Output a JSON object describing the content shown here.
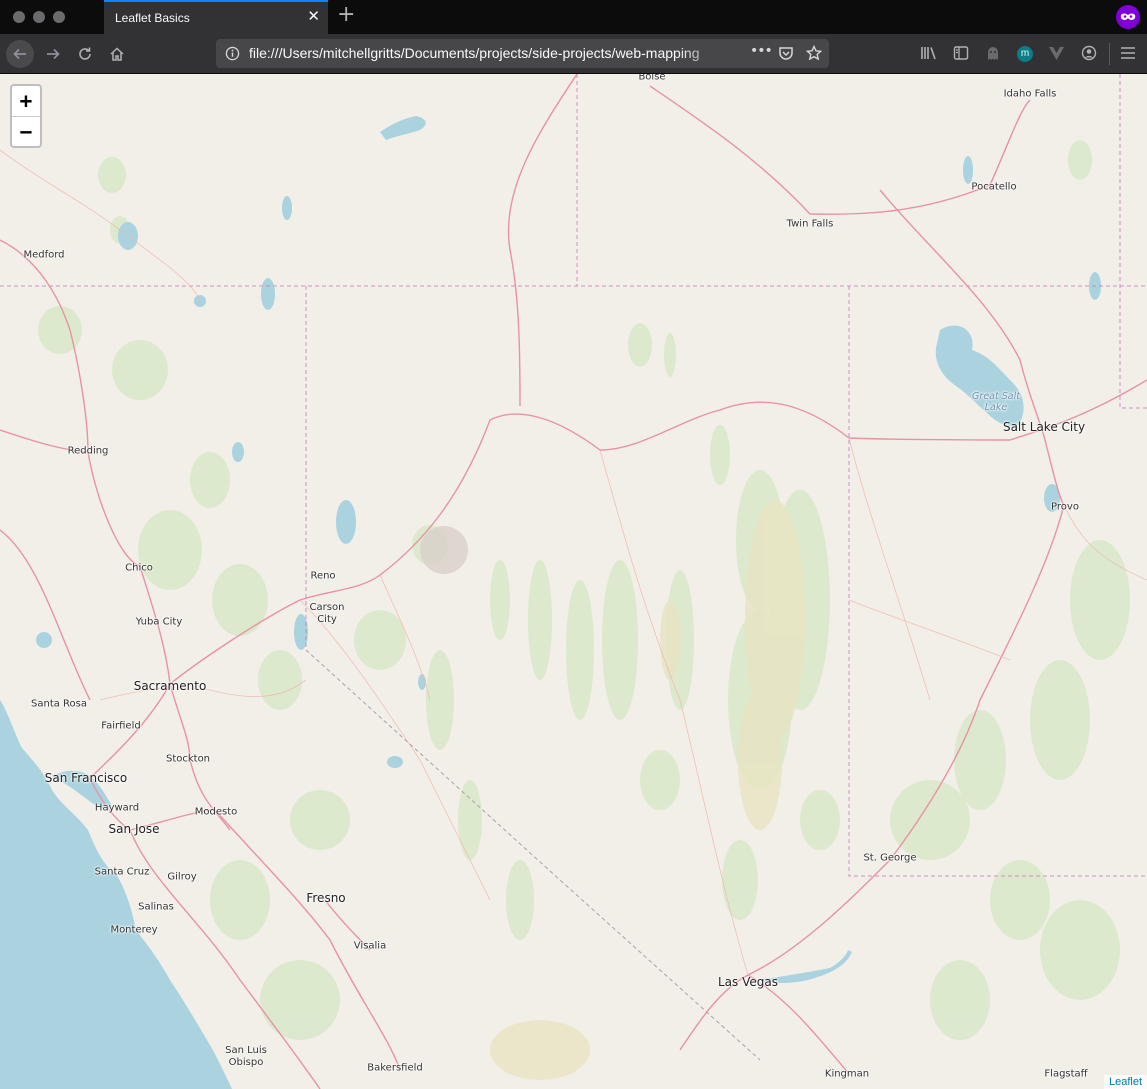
{
  "browser": {
    "tab_title": "Leaflet Basics",
    "url": "file:///Users/mitchellgritts/Documents/projects/side-projects/web-mapping",
    "page_actions_label": "•••"
  },
  "map": {
    "zoom_in_label": "+",
    "zoom_out_label": "−",
    "attribution": "Leaflet",
    "places": [
      {
        "name": "Boise"
      },
      {
        "name": "Idaho Falls"
      },
      {
        "name": "Pocatello"
      },
      {
        "name": "Twin Falls"
      },
      {
        "name": "Medford"
      },
      {
        "name": "Great Salt Lake"
      },
      {
        "name": "Salt Lake City"
      },
      {
        "name": "Provo"
      },
      {
        "name": "Redding"
      },
      {
        "name": "Chico"
      },
      {
        "name": "Reno"
      },
      {
        "name": "Carson City"
      },
      {
        "name": "Yuba City"
      },
      {
        "name": "Sacramento"
      },
      {
        "name": "Santa Rosa"
      },
      {
        "name": "Fairfield"
      },
      {
        "name": "Stockton"
      },
      {
        "name": "San Francisco"
      },
      {
        "name": "Hayward"
      },
      {
        "name": "Modesto"
      },
      {
        "name": "San Jose"
      },
      {
        "name": "Santa Cruz"
      },
      {
        "name": "Gilroy"
      },
      {
        "name": "Salinas"
      },
      {
        "name": "Monterey"
      },
      {
        "name": "Fresno"
      },
      {
        "name": "Visalia"
      },
      {
        "name": "St. George"
      },
      {
        "name": "Las Vegas"
      },
      {
        "name": "San Luis Obispo"
      },
      {
        "name": "Bakersfield"
      },
      {
        "name": "Kingman"
      },
      {
        "name": "Flagstaff"
      }
    ]
  }
}
